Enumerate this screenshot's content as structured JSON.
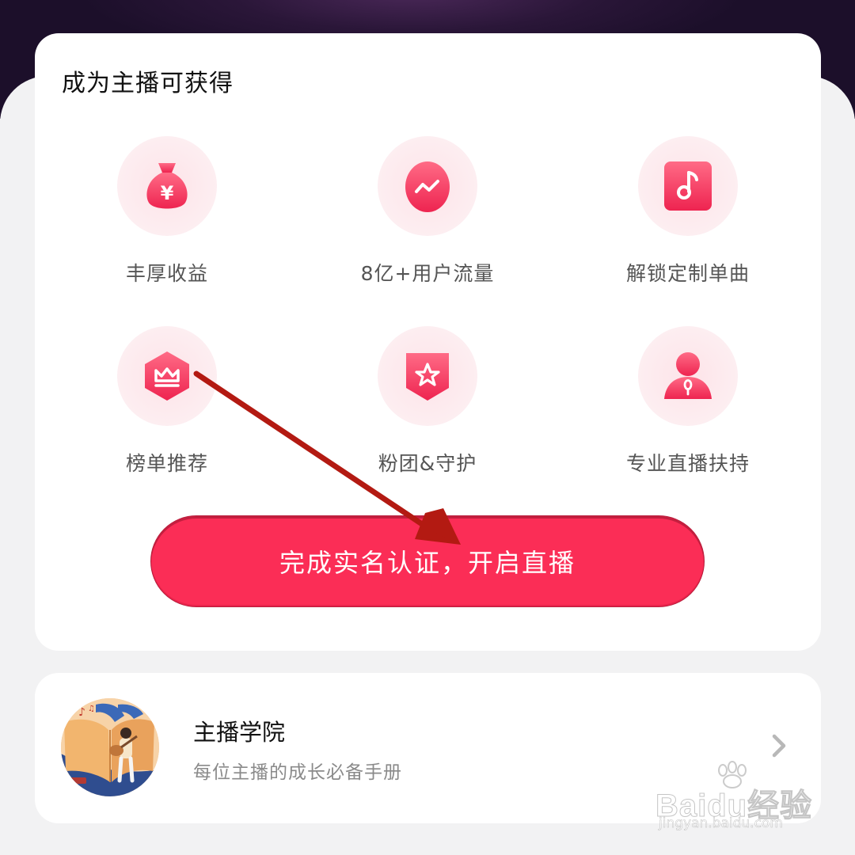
{
  "benefits_card": {
    "title": "成为主播可获得",
    "items": [
      {
        "label": "丰厚收益",
        "icon": "money-bag-icon"
      },
      {
        "label": "8亿+用户流量",
        "icon": "traffic-egg-icon"
      },
      {
        "label": "解锁定制单曲",
        "icon": "music-note-icon"
      },
      {
        "label": "榜单推荐",
        "icon": "crown-hexagon-icon"
      },
      {
        "label": "粉团&守护",
        "icon": "star-shield-icon"
      },
      {
        "label": "专业直播扶持",
        "icon": "person-mic-icon"
      }
    ],
    "cta_label": "完成实名认证，开启直播"
  },
  "academy_card": {
    "title": "主播学院",
    "subtitle": "每位主播的成长必备手册",
    "avatar_icon": "book-guitar-illustration"
  },
  "watermark": {
    "brand": "Baidu经验",
    "url": "jingyan.baidu.com"
  },
  "colors": {
    "accent": "#fb2d56",
    "icon_red": "#f0385c",
    "annotation_arrow": "#b31a12"
  }
}
